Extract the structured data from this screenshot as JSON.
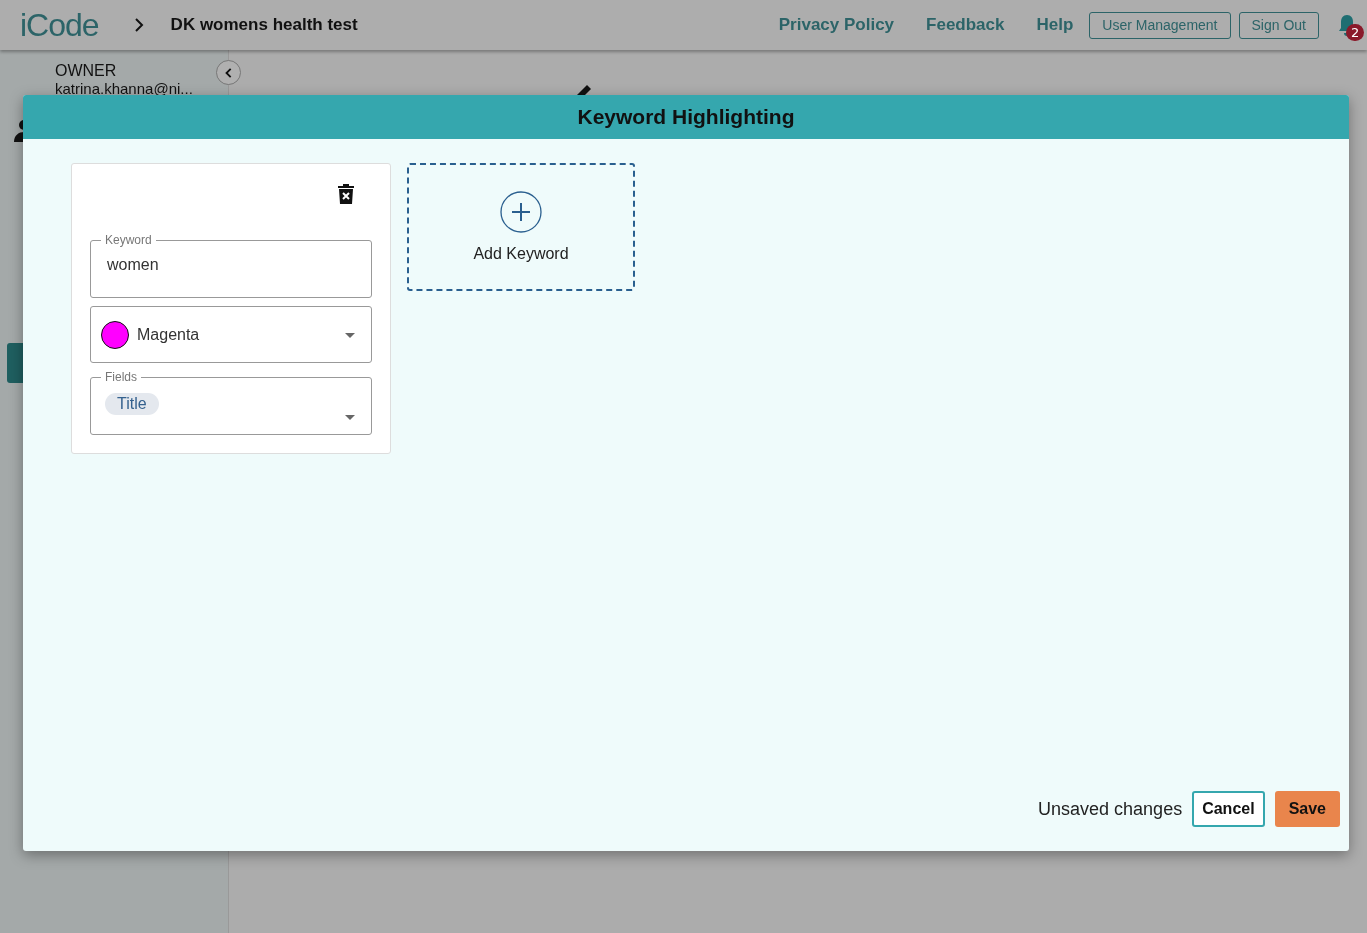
{
  "header": {
    "logo": "iCode",
    "project": "DK womens health test",
    "links": [
      "Privacy Policy",
      "Feedback",
      "Help"
    ],
    "buttons": [
      "User Management",
      "Sign Out"
    ],
    "notification_count": "2"
  },
  "sidebar": {
    "role": "OWNER",
    "email": "katrina.khanna@ni..."
  },
  "modal": {
    "title": "Keyword Highlighting",
    "keywords": [
      {
        "keyword_label": "Keyword",
        "keyword": "women",
        "color_name": "Magenta",
        "color": "#ff00ff",
        "fields_label": "Fields",
        "fields": [
          "Title"
        ]
      }
    ],
    "add_label": "Add Keyword",
    "status": "Unsaved changes",
    "cancel": "Cancel",
    "save": "Save"
  }
}
